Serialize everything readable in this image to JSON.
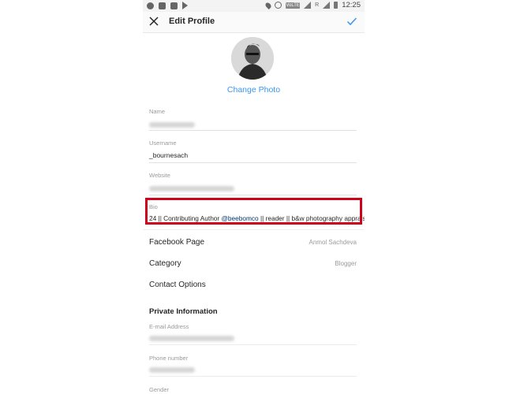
{
  "status_bar": {
    "left_icons": [
      "messenger-icon",
      "twitch-icon",
      "gallery-icon",
      "play-store-icon"
    ],
    "right_icons": [
      "location-icon",
      "alarm-icon",
      "volte-icon",
      "signal-icon",
      "roaming-signal-icon",
      "battery-icon"
    ],
    "volte_label": "VoLTE",
    "roaming_label": "R",
    "time": "12:25"
  },
  "app_bar": {
    "title": "Edit Profile",
    "close_icon": "close-icon",
    "confirm_icon": "check-icon"
  },
  "profile": {
    "change_photo_label": "Change Photo"
  },
  "fields": {
    "name": {
      "label": "Name",
      "value": ""
    },
    "username": {
      "label": "Username",
      "value": "_bournesach"
    },
    "website": {
      "label": "Website",
      "value": ""
    },
    "bio": {
      "label": "Bio",
      "prefix": "24 || Contributing Author ",
      "mention": "@beebomco",
      "suffix": " || reader || b&w photography appraiser"
    }
  },
  "rows": {
    "facebook_page": {
      "label": "Facebook Page",
      "value": "Anmol Sachdeva"
    },
    "category": {
      "label": "Category",
      "value": "Blogger"
    },
    "contact_options": {
      "label": "Contact Options"
    }
  },
  "private_info": {
    "title": "Private Information",
    "email": {
      "label": "E-mail Address",
      "value": ""
    },
    "phone": {
      "label": "Phone number",
      "value": ""
    },
    "gender": {
      "label": "Gender"
    }
  },
  "colors": {
    "accent": "#3897f0",
    "highlight": "#d0021b",
    "mention": "#003569"
  }
}
